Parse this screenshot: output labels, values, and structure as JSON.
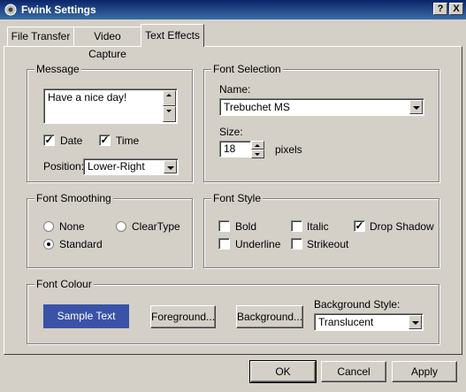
{
  "window": {
    "title": "Fwink Settings",
    "help_label": "?",
    "close_label": "X"
  },
  "tabs": [
    {
      "label": "File Transfer",
      "active": false
    },
    {
      "label": "Video Capture",
      "active": false
    },
    {
      "label": "Text Effects",
      "active": true
    }
  ],
  "message": {
    "group_label": "Message",
    "text": "Have a nice day!",
    "date_label": "Date",
    "date_checked": true,
    "time_label": "Time",
    "time_checked": true,
    "position_label": "Position:",
    "position_value": "Lower-Right"
  },
  "font_selection": {
    "group_label": "Font Selection",
    "name_label": "Name:",
    "name_value": "Trebuchet MS",
    "size_label": "Size:",
    "size_value": "18",
    "size_unit": "pixels"
  },
  "font_smoothing": {
    "group_label": "Font Smoothing",
    "options": [
      {
        "label": "None",
        "selected": false
      },
      {
        "label": "ClearType",
        "selected": false
      },
      {
        "label": "Standard",
        "selected": true
      }
    ]
  },
  "font_style": {
    "group_label": "Font Style",
    "options": [
      {
        "label": "Bold",
        "checked": false
      },
      {
        "label": "Italic",
        "checked": false
      },
      {
        "label": "Drop Shadow",
        "checked": true
      },
      {
        "label": "Underline",
        "checked": false
      },
      {
        "label": "Strikeout",
        "checked": false
      }
    ]
  },
  "font_colour": {
    "group_label": "Font Colour",
    "sample_text": "Sample Text",
    "sample_bg": "#3a52a8",
    "foreground_label": "Foreground...",
    "background_label": "Background...",
    "background_style_label": "Background Style:",
    "background_style_value": "Translucent"
  },
  "footer": {
    "ok_label": "OK",
    "cancel_label": "Cancel",
    "apply_label": "Apply"
  }
}
